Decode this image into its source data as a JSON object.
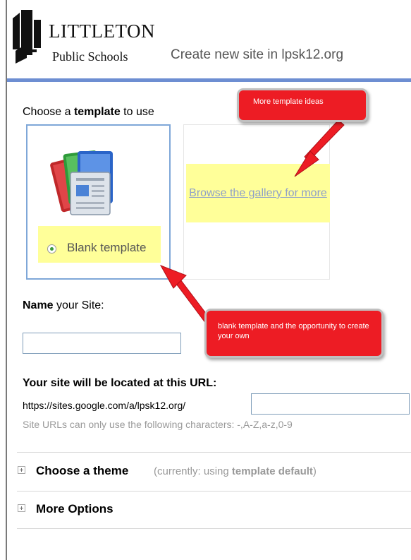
{
  "header": {
    "logo_line1": "LITTLETON",
    "logo_line2": "Public Schools",
    "title": "Create new site in lpsk12.org"
  },
  "template_section": {
    "heading_prefix": "Choose a ",
    "heading_bold": "template",
    "heading_suffix": " to use",
    "blank_label": "Blank template",
    "gallery_link": "Browse the gallery for more"
  },
  "callouts": {
    "top": "More template ideas",
    "bottom": "blank template and the opportunity to create your own"
  },
  "name_section": {
    "label_bold": "Name",
    "label_rest": " your Site:",
    "input_value": ""
  },
  "url_section": {
    "heading": "Your site will be located at this URL:",
    "prefix": "https://sites.google.com/a/lpsk12.org/",
    "input_value": "",
    "hint": "Site URLs can only use the following characters: -,A-Z,a-z,0-9"
  },
  "theme_section": {
    "title": "Choose a theme",
    "note_prefix": "(currently: using ",
    "note_bold": "template default",
    "note_suffix": ")"
  },
  "more_options": {
    "title": "More Options"
  },
  "colors": {
    "header_bar": "#6d8ed2",
    "callout_red": "#ed1c24",
    "highlight_yellow": "#ffff99",
    "link_blue": "#8fa0c8"
  },
  "icons": [
    "littleton-logo-icon",
    "template-pages-icon",
    "radio-selected-icon",
    "expand-plus-icon"
  ]
}
